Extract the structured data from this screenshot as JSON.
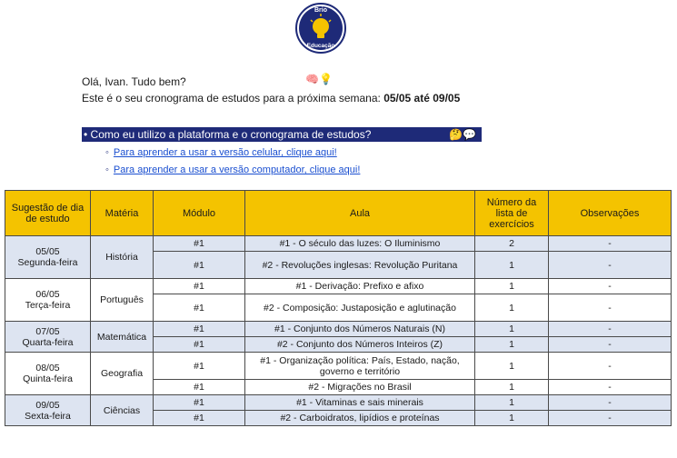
{
  "logo": {
    "text_top": "Brio",
    "text_bottom": "Educação"
  },
  "greeting": "Olá, Ivan. Tudo bem?",
  "greeting_icons": "🧠💡",
  "intro": {
    "text": "Este é o seu cronograma de estudos para a próxima semana: ",
    "dates": "05/05 até 09/05"
  },
  "howto": {
    "label": "• Como eu utilizo a plataforma e o cronograma de estudos?",
    "emoji": "🤔💬"
  },
  "links": [
    {
      "bullet": "◦",
      "text": "Para aprender a usar a versão celular, clique aqui!"
    },
    {
      "bullet": "◦",
      "text": "Para aprender a usar a versão computador, clique aqui!"
    }
  ],
  "table": {
    "headers": [
      "Sugestão de dia de estudo",
      "Matéria",
      "Módulo",
      "Aula",
      "Número da lista de exercícios",
      "Observações"
    ],
    "days": [
      {
        "date": "05/05",
        "weekday": "Segunda-feira",
        "subject": "História",
        "rows": [
          {
            "module": "#1",
            "lesson": "#1 - O século das luzes: O Iluminismo",
            "list": "2",
            "obs": "-"
          },
          {
            "module": "#1",
            "lesson": "#2 - Revoluções inglesas: Revolução Puritana",
            "list": "1",
            "obs": "-"
          }
        ]
      },
      {
        "date": "06/05",
        "weekday": "Terça-feira",
        "subject": "Português",
        "rows": [
          {
            "module": "#1",
            "lesson": "#1 - Derivação: Prefixo e afixo",
            "list": "1",
            "obs": "-"
          },
          {
            "module": "#1",
            "lesson": "#2 - Composição: Justaposição e aglutinação",
            "list": "1",
            "obs": "-"
          }
        ]
      },
      {
        "date": "07/05",
        "weekday": "Quarta-feira",
        "subject": "Matemática",
        "rows": [
          {
            "module": "#1",
            "lesson": "#1 - Conjunto dos Números Naturais (N)",
            "list": "1",
            "obs": "-"
          },
          {
            "module": "#1",
            "lesson": "#2 - Conjunto dos Números Inteiros (Z)",
            "list": "1",
            "obs": "-"
          }
        ]
      },
      {
        "date": "08/05",
        "weekday": "Quinta-feira",
        "subject": "Geografia",
        "rows": [
          {
            "module": "#1",
            "lesson": "#1 - Organização política: País, Estado, nação, governo e território",
            "list": "1",
            "obs": "-"
          },
          {
            "module": "#1",
            "lesson": "#2 - Migrações no Brasil",
            "list": "1",
            "obs": "-"
          }
        ]
      },
      {
        "date": "09/05",
        "weekday": "Sexta-feira",
        "subject": "Ciências",
        "rows": [
          {
            "module": "#1",
            "lesson": "#1 - Vitaminas e sais minerais",
            "list": "1",
            "obs": "-"
          },
          {
            "module": "#1",
            "lesson": "#2 - Carboidratos, lipídios e proteínas",
            "list": "1",
            "obs": "-"
          }
        ]
      }
    ]
  }
}
